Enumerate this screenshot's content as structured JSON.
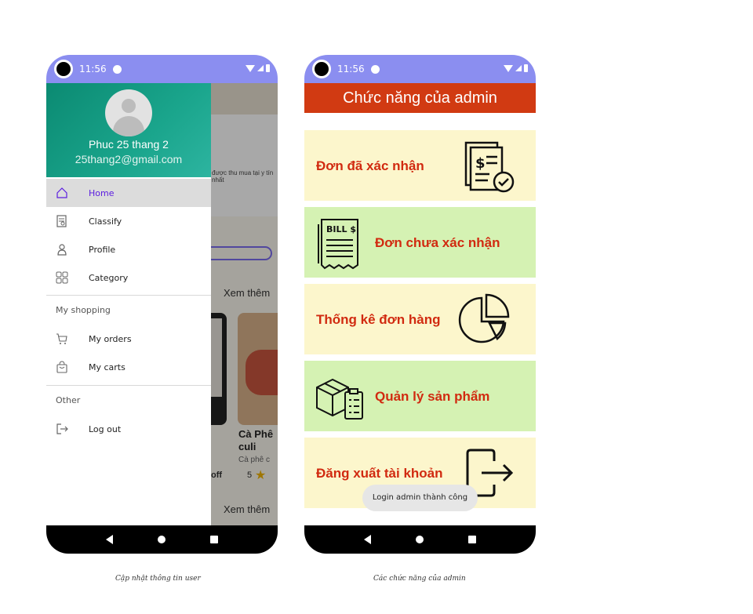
{
  "status_bar": {
    "time": "11:56"
  },
  "left_screen": {
    "background": {
      "banner_text": "được thu mua tại y tín nhất",
      "see_more_1": "Xem thêm",
      "product_name": "Cà Phê culi",
      "product_sub": "Cà phê c",
      "product_off": "off",
      "product_rating": "5",
      "see_more_2": "Xem thêm"
    },
    "drawer": {
      "user_name": "Phuc 25 thang 2",
      "user_email": "25thang2@gmail.com",
      "items": [
        {
          "label": "Home",
          "icon": "home-icon",
          "active": true
        },
        {
          "label": "Classify",
          "icon": "classify-icon"
        },
        {
          "label": "Profile",
          "icon": "profile-icon"
        },
        {
          "label": "Category",
          "icon": "category-icon"
        }
      ],
      "section_shopping": "My shopping",
      "shopping_items": [
        {
          "label": "My orders",
          "icon": "cart-icon"
        },
        {
          "label": "My carts",
          "icon": "bag-icon"
        }
      ],
      "section_other": "Other",
      "other_items": [
        {
          "label": "Log out",
          "icon": "logout-icon"
        }
      ]
    },
    "caption": "Cập nhật thông tin user"
  },
  "right_screen": {
    "title": "Chức năng của admin",
    "tiles": [
      {
        "label": "Đơn đã xác nhận",
        "icon": "confirmed-invoice-icon",
        "color": "#fcf6cc"
      },
      {
        "label": "Đơn chưa xác nhận",
        "icon": "bill-icon",
        "color": "#d5f2b3"
      },
      {
        "label": "Thống kê đơn hàng",
        "icon": "pie-chart-icon",
        "color": "#fcf6cc"
      },
      {
        "label": "Quản lý sản phẩm",
        "icon": "product-box-icon",
        "color": "#d5f2b3"
      },
      {
        "label": "Đăng xuất tài khoản",
        "icon": "logout-icon",
        "color": "#fcf6cc"
      }
    ],
    "toast": "Login admin thành công",
    "caption": "Các chức năng của admin"
  },
  "colors": {
    "status_bar": "#8b8ef0",
    "drawer_header": "#0b8a72",
    "admin_title_bar": "#d13a12",
    "tile_label": "#d12a10",
    "active_menu_label": "#5b1de0"
  }
}
